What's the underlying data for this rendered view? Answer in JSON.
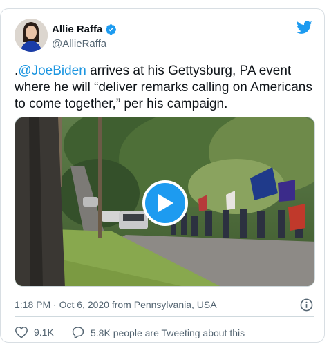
{
  "tweet": {
    "author_name": "Allie Raffa",
    "author_handle": "@AllieRaffa",
    "text_prefix": ".",
    "mention": "@JoeBiden",
    "text_rest": " arrives at his Gettysburg, PA event where he will “deliver remarks calling on Americans to come together,” per his campaign.",
    "timestamp": "1:18 PM · Oct 6, 2020 from Pennsylvania, USA",
    "like_count": "9.1K",
    "tweeting_text": "5.8K people are Tweeting about this"
  },
  "icons": {
    "verified": "verified-badge-icon",
    "brand": "twitter-bird-icon",
    "play": "play-icon",
    "info": "info-icon",
    "like": "heart-icon",
    "comment": "comment-icon"
  },
  "colors": {
    "accent": "#1d9bf0",
    "link": "#1b95e0",
    "secondary_text": "#536471"
  }
}
